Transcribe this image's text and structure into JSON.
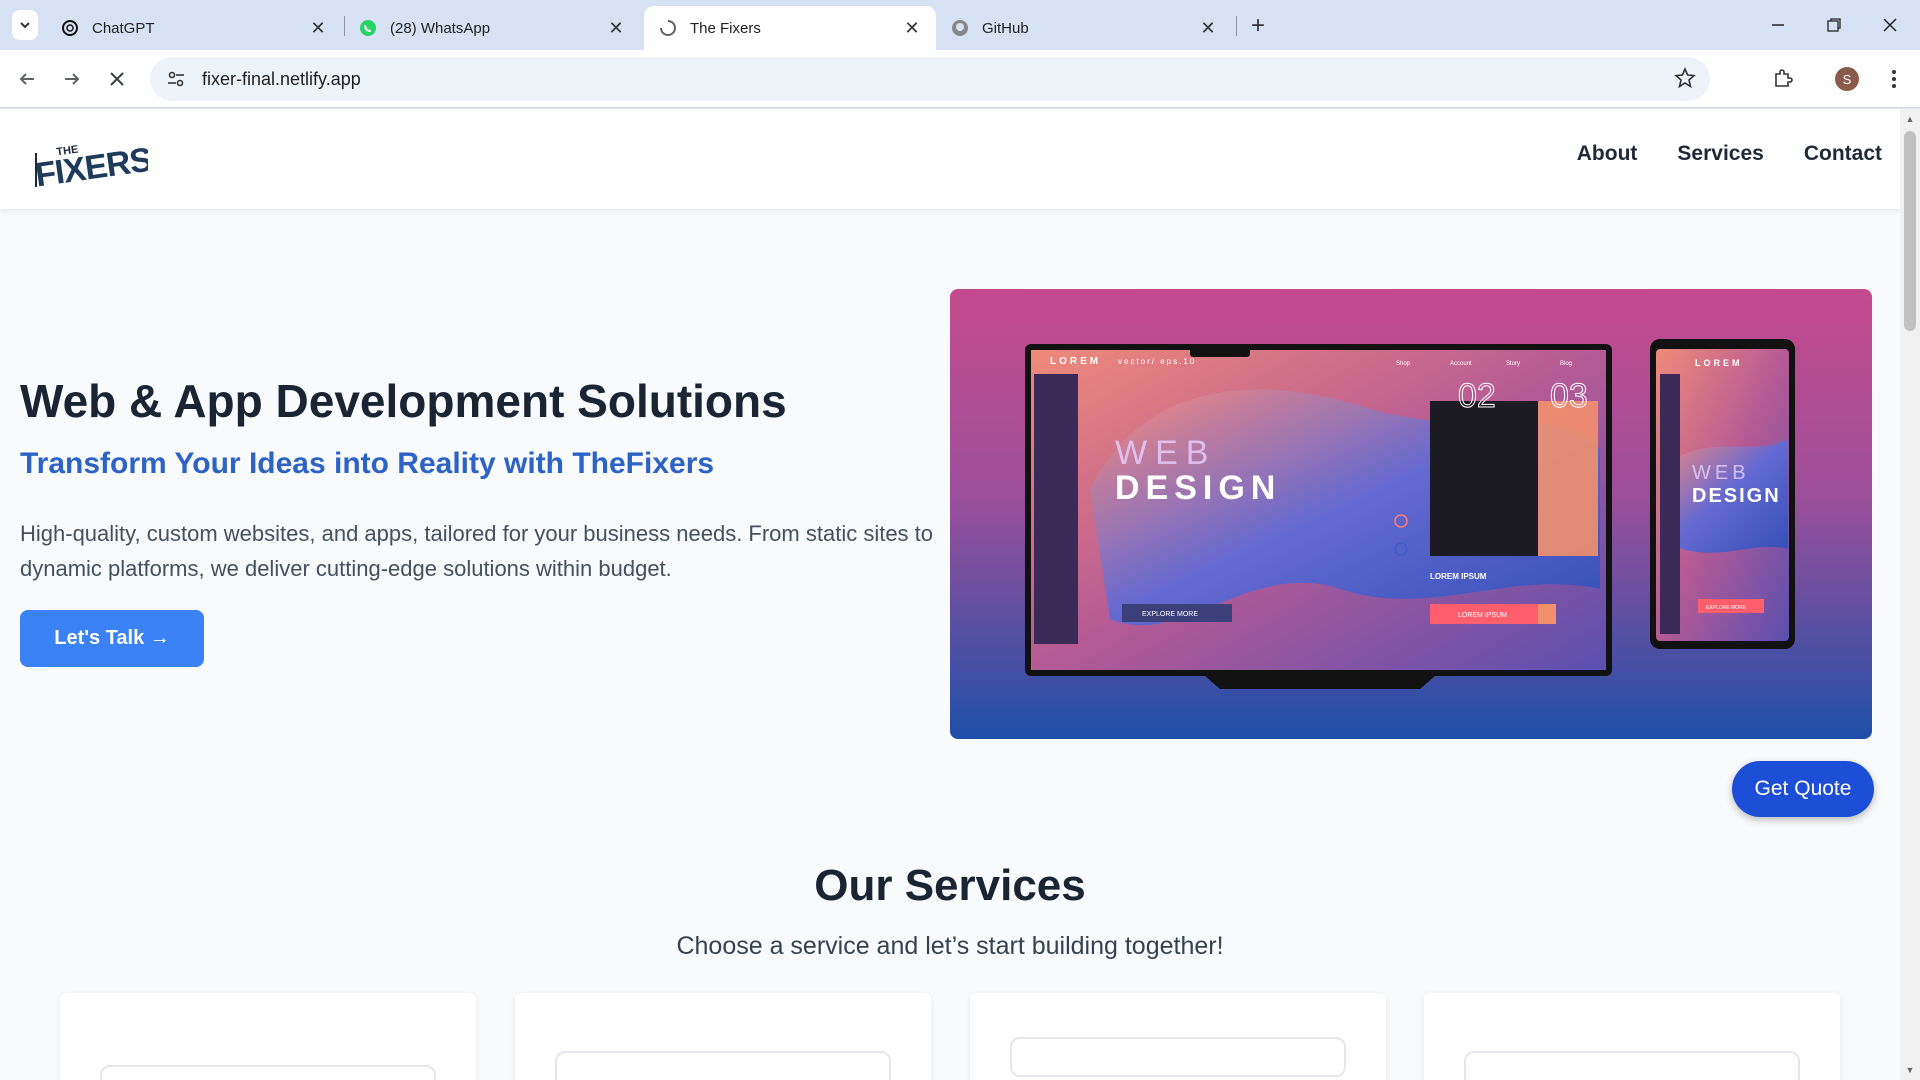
{
  "browser": {
    "tabs": [
      {
        "title": "ChatGPT",
        "icon": "chatgpt-icon",
        "active": false
      },
      {
        "title": "(28) WhatsApp",
        "icon": "whatsapp-icon",
        "active": false
      },
      {
        "title": "The Fixers",
        "icon": "loading-icon",
        "active": true
      },
      {
        "title": "GitHub",
        "icon": "github-icon",
        "active": false
      }
    ],
    "url": "fixer-final.netlify.app",
    "profile_initial": "S"
  },
  "site": {
    "logo_text": "THE FIXERS",
    "nav": [
      "About",
      "Services",
      "Contact"
    ],
    "hero": {
      "title": "Web & App Development Solutions",
      "subtitle": "Transform Your Ideas into Reality with TheFixers",
      "description": "High-quality, custom websites, and apps, tailored for your business needs. From static sites to dynamic platforms, we deliver cutting-edge solutions within budget.",
      "cta": "Let's Talk →"
    },
    "hero_image_text": {
      "brand": "LOREM",
      "tagline": "vector/ eps.10",
      "menu": [
        "Shop",
        "Account",
        "Story",
        "Blog"
      ],
      "headline_1": "WEB",
      "headline_2": "DESIGN",
      "num_1": "02",
      "num_2": "03",
      "button_1": "EXPLORE MORE",
      "card_title": "LOREM IPSUM",
      "button_2": "LOREM IPSUM",
      "button_3": "EXPLORE MORE"
    },
    "quote_button": "Get Quote",
    "services": {
      "title": "Our Services",
      "subtitle": "Choose a service and let’s start building together!"
    }
  },
  "colors": {
    "accent": "#3b82f6",
    "accent_dark": "#1d4ed8",
    "subtitle": "#2d62c6"
  }
}
